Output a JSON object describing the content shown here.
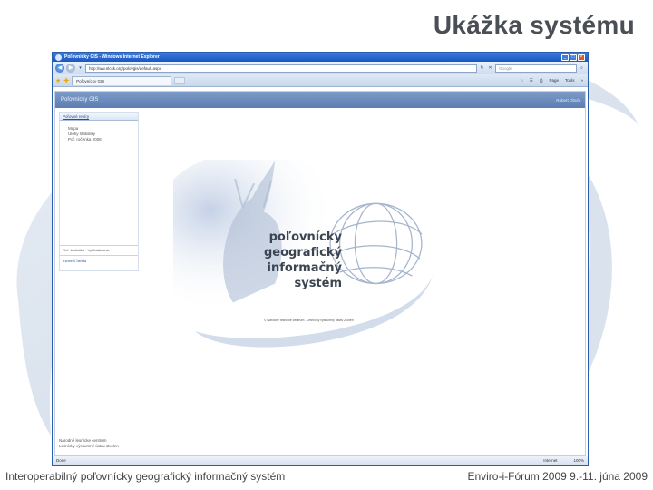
{
  "slide": {
    "title": "Ukážka systému",
    "footer_left": "Interoperabilný poľovnícky geografický informačný systém",
    "footer_right": "Enviro-i-Fórum 2009 9.-11. júna 2009"
  },
  "browser": {
    "window_title": "Poľovnícky GIS - Windows Internet Explorer",
    "url": "http://ww.nlcsk.org/polovgis/default.aspx",
    "search_placeholder": "Google",
    "tab_label": "Poľovnícky GIS",
    "menu": {
      "page": "Page",
      "tools": "Tools"
    },
    "status_left": "Done",
    "status_zone": "Internet",
    "zoom": "100%"
  },
  "app": {
    "title": "Poľovnícky GIS",
    "user": "Robert Obuh",
    "sidebar": {
      "head": "Poľovné revíry",
      "items": [
        "Mapa",
        "Úlohy štatistiky",
        "Poľ. ročenka 2008"
      ],
      "links": "Ref. štatistika · Vyhľadávanie",
      "bottom_link": "Zmeniť heslo"
    },
    "splash": {
      "line1": "poľovnícky",
      "line2": "geografický",
      "line3": "informačný",
      "line4": "systém",
      "caption": "© Národné lesnícke centrum - Lesnícky výskumný ústav Zvolen"
    },
    "footer_line1": "Národné lesnícke centrum",
    "footer_line2": "Lesnícky výskumný ústav Zvolen"
  },
  "colors": {
    "accent": "#1a56c0",
    "header_blue": "#5b7db3",
    "slide_title": "#4a4f55"
  }
}
